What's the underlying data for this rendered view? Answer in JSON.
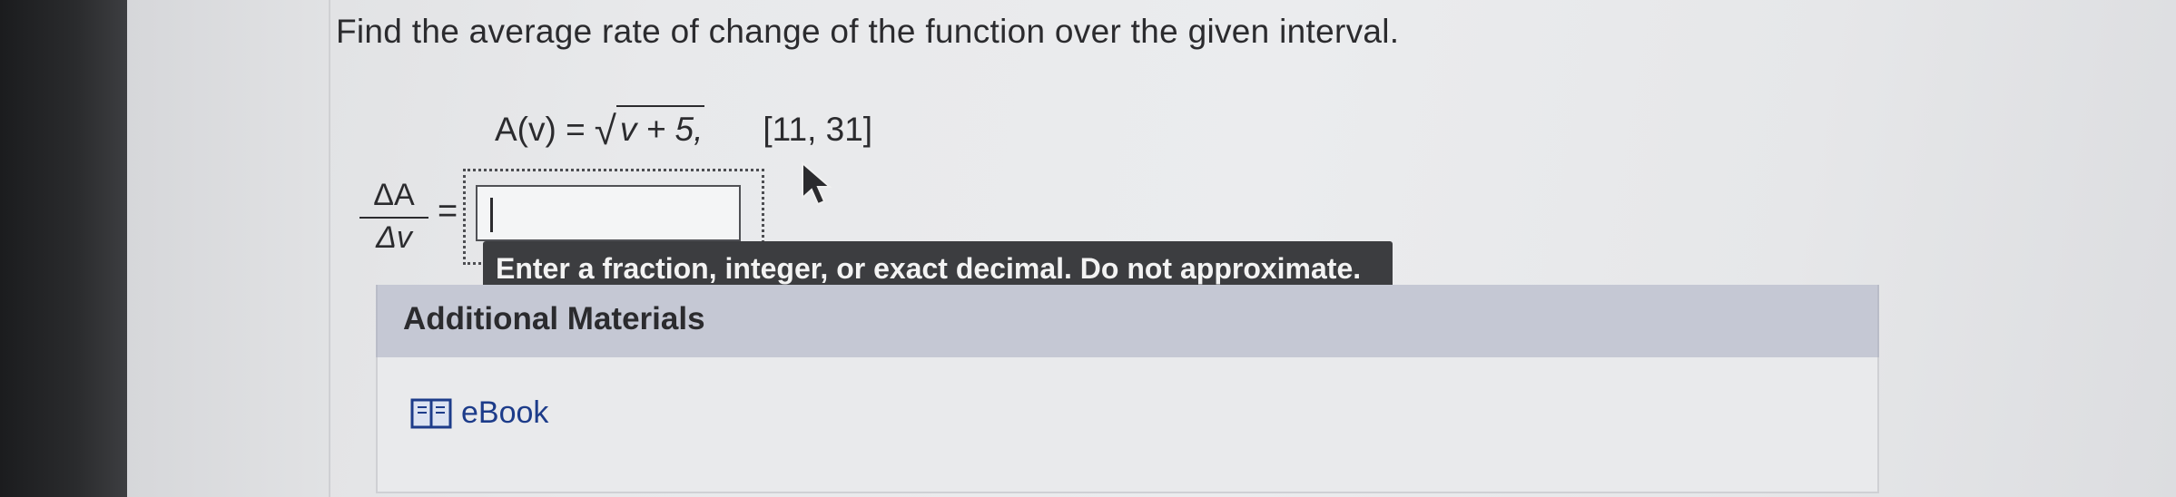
{
  "question": {
    "prompt": "Find the average rate of change of the function over the given interval.",
    "function_lhs": "A(v) =",
    "radicand": "v + 5,",
    "interval": "[11, 31]"
  },
  "answer": {
    "fraction_numerator": "ΔA",
    "fraction_denominator": "Δv",
    "equals": "=",
    "value": "",
    "hint": "Enter a fraction, integer, or exact decimal. Do not approximate."
  },
  "materials": {
    "title": "Additional Materials",
    "ebook_label": "eBook",
    "ebook_icon": "book-icon",
    "link_color": "#1d3c8a",
    "header_color": "#c5c8d4"
  }
}
